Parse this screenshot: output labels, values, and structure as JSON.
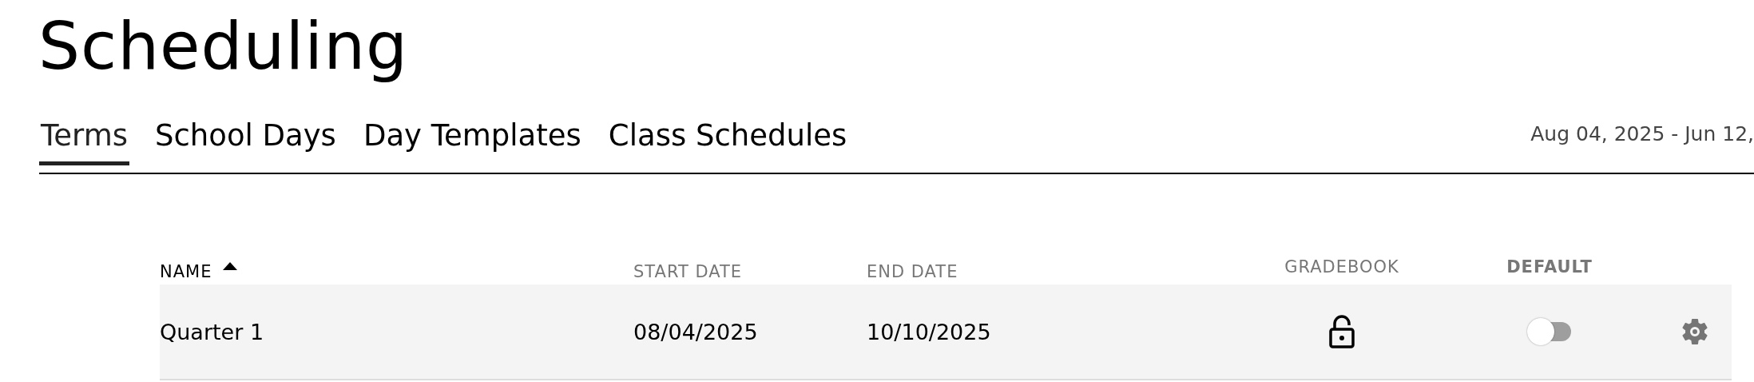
{
  "title": "Scheduling",
  "tabs": [
    {
      "label": "Terms",
      "selected": true
    },
    {
      "label": "School Days",
      "selected": false
    },
    {
      "label": "Day Templates",
      "selected": false
    },
    {
      "label": "Class Schedules",
      "selected": false
    }
  ],
  "date_range": "Aug 04, 2025 - Jun 12,",
  "table": {
    "columns": [
      {
        "label": "NAME",
        "sorted": true,
        "bold": false
      },
      {
        "label": "START DATE",
        "sorted": false,
        "bold": false
      },
      {
        "label": "END DATE",
        "sorted": false,
        "bold": false
      },
      {
        "label": "GRADEBOOK",
        "sorted": false,
        "bold": false
      },
      {
        "label": "DEFAULT",
        "sorted": false,
        "bold": true
      }
    ],
    "rows": [
      {
        "name": "Quarter 1",
        "start_date": "08/04/2025",
        "end_date": "10/10/2025",
        "gradebook_locked": false,
        "default_on": false
      }
    ]
  }
}
